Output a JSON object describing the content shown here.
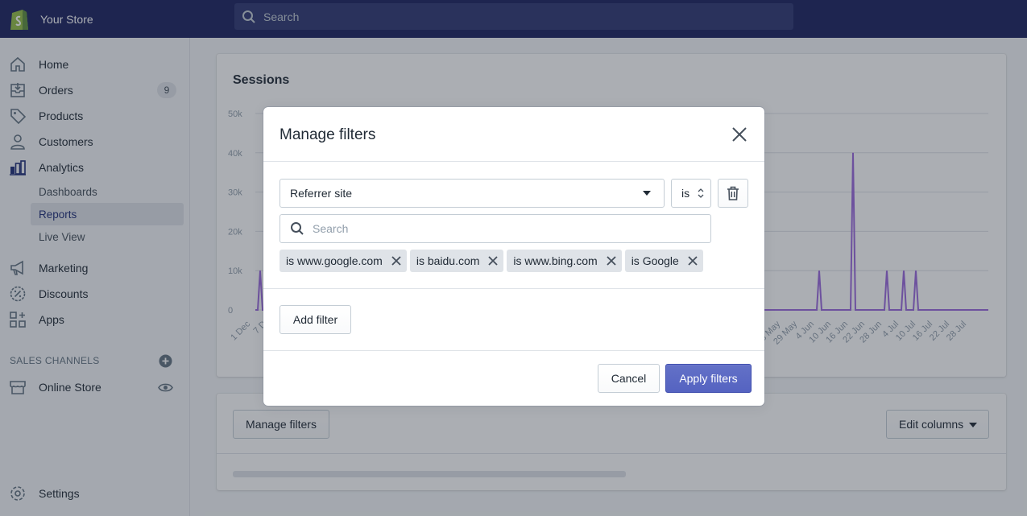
{
  "app": {
    "store_name": "Your Store",
    "search_placeholder": "Search"
  },
  "sidebar": {
    "items": [
      {
        "label": "Home",
        "icon": "home-icon"
      },
      {
        "label": "Orders",
        "icon": "orders-icon",
        "badge": "9"
      },
      {
        "label": "Products",
        "icon": "tag-icon"
      },
      {
        "label": "Customers",
        "icon": "person-icon"
      },
      {
        "label": "Analytics",
        "icon": "bar-chart-icon"
      },
      {
        "label": "Marketing",
        "icon": "megaphone-icon"
      },
      {
        "label": "Discounts",
        "icon": "discount-icon"
      },
      {
        "label": "Apps",
        "icon": "apps-icon"
      }
    ],
    "analytics_sub": [
      {
        "label": "Dashboards"
      },
      {
        "label": "Reports",
        "active": true
      },
      {
        "label": "Live View"
      }
    ],
    "sales_channels_heading": "SALES CHANNELS",
    "online_store": "Online Store",
    "settings": "Settings"
  },
  "main": {
    "sessions_title": "Sessions",
    "manage_filters_button": "Manage filters",
    "edit_columns_button": "Edit columns"
  },
  "chart_data": {
    "type": "line",
    "title": "Sessions",
    "y_ticks": [
      "50k",
      "40k",
      "30k",
      "20k",
      "10k",
      "0"
    ],
    "ylim": [
      0,
      50000
    ],
    "x_ticks_left": [
      "1 Dec",
      "7 D"
    ],
    "x_ticks_right": [
      "3 May",
      "29 May",
      "4 Jun",
      "10 Jun",
      "16 Jun",
      "22 Jun",
      "28 Jun",
      "4 Jul",
      "10 Jul",
      "16 Jul",
      "22 Jul",
      "28 Jul"
    ],
    "series_color": "#9c6ade",
    "spikes_right": [
      {
        "x_date": "4 Jun",
        "y": 10000
      },
      {
        "x_date": "16 Jun",
        "y": 40000
      },
      {
        "x_date": "28 Jun",
        "y": 10000
      },
      {
        "x_date": "4 Jul",
        "y": 10000
      },
      {
        "x_date": "4 Jul",
        "y": 10000
      }
    ],
    "spike_left": {
      "x_date": "1 Dec",
      "y": 10000
    }
  },
  "modal": {
    "title": "Manage filters",
    "field_select": "Referrer site",
    "operator_select": "is",
    "search_placeholder": "Search",
    "tags": [
      {
        "label": "is www.google.com"
      },
      {
        "label": "is baidu.com"
      },
      {
        "label": "is www.bing.com"
      },
      {
        "label": "is Google"
      }
    ],
    "add_filter": "Add filter",
    "cancel": "Cancel",
    "apply": "Apply filters"
  }
}
